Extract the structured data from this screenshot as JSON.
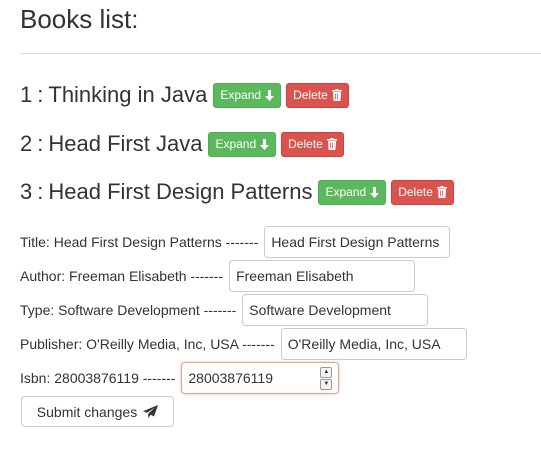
{
  "page": {
    "title": "Books list:"
  },
  "books": [
    {
      "index": "1",
      "separator": ":",
      "title": "Thinking in Java",
      "expand_label": "Expand",
      "delete_label": "Delete"
    },
    {
      "index": "2",
      "separator": ":",
      "title": "Head First Java",
      "expand_label": "Expand",
      "delete_label": "Delete"
    },
    {
      "index": "3",
      "separator": ":",
      "title": "Head First Design Patterns",
      "expand_label": "Expand",
      "delete_label": "Delete"
    }
  ],
  "icons": {
    "expand": "arrow-down-icon",
    "delete": "trash-icon",
    "submit": "paper-plane-icon"
  },
  "colors": {
    "expand": "#5cb85c",
    "delete": "#d9534f",
    "focus_border": "#e8a38d"
  },
  "form": {
    "title": {
      "label": "Title: Head First Design Patterns -------",
      "value": "Head First Design Patterns"
    },
    "author": {
      "label": "Author: Freeman Elisabeth -------",
      "value": "Freeman Elisabeth"
    },
    "type": {
      "label": "Type: Software Development -------",
      "value": "Software Development"
    },
    "publisher": {
      "label": "Publisher: O'Reilly Media, Inc, USA -------",
      "value": "O'Reilly Media, Inc, USA"
    },
    "isbn": {
      "label": "Isbn: 28003876119 -------",
      "value": "28003876119"
    },
    "submit_label": "Submit changes"
  }
}
